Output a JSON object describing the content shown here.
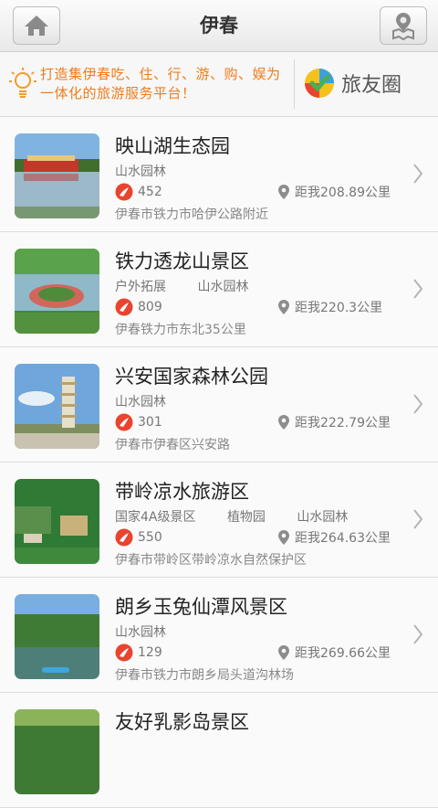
{
  "header": {
    "title": "伊春"
  },
  "banner": {
    "slogan_line1": "打造集伊春吃、住、行、游、购、娱为",
    "slogan_line2": "一体化的旅游服务平台！",
    "circle_label": "旅友圈"
  },
  "items": [
    {
      "name": "映山湖生态园",
      "tags": [
        "山水园林"
      ],
      "likes": "452",
      "distance": "距我208.89公里",
      "address": "伊春市铁力市哈伊公路附近"
    },
    {
      "name": "铁力透龙山景区",
      "tags": [
        "户外拓展",
        "山水园林"
      ],
      "likes": "809",
      "distance": "距我220.3公里",
      "address": "伊春铁力市东北35公里"
    },
    {
      "name": "兴安国家森林公园",
      "tags": [
        "山水园林"
      ],
      "likes": "301",
      "distance": "距我222.79公里",
      "address": "伊春市伊春区兴安路"
    },
    {
      "name": "带岭凉水旅游区",
      "tags": [
        "国家4A级景区",
        "植物园",
        "山水园林"
      ],
      "likes": "550",
      "distance": "距我264.63公里",
      "address": "伊春市带岭区带岭凉水自然保护区"
    },
    {
      "name": "朗乡玉兔仙潭风景区",
      "tags": [
        "山水园林"
      ],
      "likes": "129",
      "distance": "距我269.66公里",
      "address": "伊春市铁力市朗乡局头道沟林场"
    },
    {
      "name": "友好乳影岛景区",
      "tags": [],
      "likes": "",
      "distance": "",
      "address": ""
    }
  ]
}
